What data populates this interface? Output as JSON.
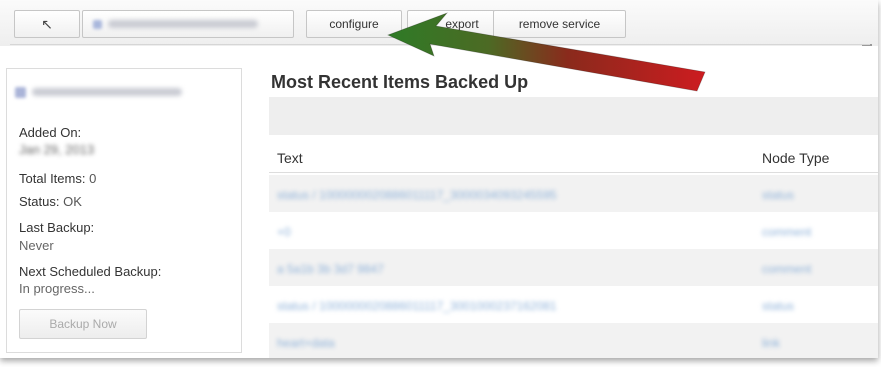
{
  "toolbar": {
    "back_icon_glyph": "↖",
    "service_name": "",
    "configure_label": "configure",
    "export_label": "export",
    "remove_label": "remove service"
  },
  "sidebar": {
    "service_title": "",
    "added_on_label": "Added On:",
    "added_on_value": "Jan 29, 2013",
    "total_items_label": "Total Items:",
    "total_items_value": "0",
    "status_label": "Status:",
    "status_value": "OK",
    "last_backup_label": "Last Backup:",
    "last_backup_value": "Never",
    "next_backup_label": "Next Scheduled Backup:",
    "next_backup_value": "In progress...",
    "backup_now_label": "Backup Now"
  },
  "main": {
    "title": "Most Recent Items Backed Up",
    "columns": {
      "text": "Text",
      "node_type": "Node Type"
    },
    "rows": [
      {
        "text": "status / 1000000020886011117_3000034093245595",
        "node_type": "status"
      },
      {
        "text": "+0",
        "node_type": "comment"
      },
      {
        "text": "a 5a1b 3b 3d7 9847",
        "node_type": "comment"
      },
      {
        "text": "status / 1000000020886011117_3001000237162081",
        "node_type": "status"
      },
      {
        "text": "heart+data",
        "node_type": "link"
      }
    ]
  },
  "colors": {
    "arrow_green": "#3f7f2a",
    "arrow_red": "#c8141b",
    "link_blue": "#8fb2d9"
  }
}
